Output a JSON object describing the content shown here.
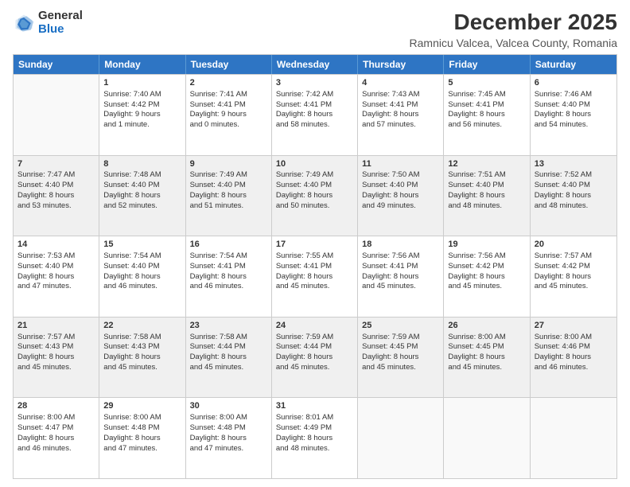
{
  "logo": {
    "general": "General",
    "blue": "Blue"
  },
  "title": "December 2025",
  "subtitle": "Ramnicu Valcea, Valcea County, Romania",
  "header_days": [
    "Sunday",
    "Monday",
    "Tuesday",
    "Wednesday",
    "Thursday",
    "Friday",
    "Saturday"
  ],
  "rows": [
    [
      {
        "day": "",
        "content": "",
        "empty": true
      },
      {
        "day": "1",
        "content": "Sunrise: 7:40 AM\nSunset: 4:42 PM\nDaylight: 9 hours\nand 1 minute."
      },
      {
        "day": "2",
        "content": "Sunrise: 7:41 AM\nSunset: 4:41 PM\nDaylight: 9 hours\nand 0 minutes."
      },
      {
        "day": "3",
        "content": "Sunrise: 7:42 AM\nSunset: 4:41 PM\nDaylight: 8 hours\nand 58 minutes."
      },
      {
        "day": "4",
        "content": "Sunrise: 7:43 AM\nSunset: 4:41 PM\nDaylight: 8 hours\nand 57 minutes."
      },
      {
        "day": "5",
        "content": "Sunrise: 7:45 AM\nSunset: 4:41 PM\nDaylight: 8 hours\nand 56 minutes."
      },
      {
        "day": "6",
        "content": "Sunrise: 7:46 AM\nSunset: 4:40 PM\nDaylight: 8 hours\nand 54 minutes."
      }
    ],
    [
      {
        "day": "7",
        "content": "Sunrise: 7:47 AM\nSunset: 4:40 PM\nDaylight: 8 hours\nand 53 minutes.",
        "shaded": true
      },
      {
        "day": "8",
        "content": "Sunrise: 7:48 AM\nSunset: 4:40 PM\nDaylight: 8 hours\nand 52 minutes.",
        "shaded": true
      },
      {
        "day": "9",
        "content": "Sunrise: 7:49 AM\nSunset: 4:40 PM\nDaylight: 8 hours\nand 51 minutes.",
        "shaded": true
      },
      {
        "day": "10",
        "content": "Sunrise: 7:49 AM\nSunset: 4:40 PM\nDaylight: 8 hours\nand 50 minutes.",
        "shaded": true
      },
      {
        "day": "11",
        "content": "Sunrise: 7:50 AM\nSunset: 4:40 PM\nDaylight: 8 hours\nand 49 minutes.",
        "shaded": true
      },
      {
        "day": "12",
        "content": "Sunrise: 7:51 AM\nSunset: 4:40 PM\nDaylight: 8 hours\nand 48 minutes.",
        "shaded": true
      },
      {
        "day": "13",
        "content": "Sunrise: 7:52 AM\nSunset: 4:40 PM\nDaylight: 8 hours\nand 48 minutes.",
        "shaded": true
      }
    ],
    [
      {
        "day": "14",
        "content": "Sunrise: 7:53 AM\nSunset: 4:40 PM\nDaylight: 8 hours\nand 47 minutes."
      },
      {
        "day": "15",
        "content": "Sunrise: 7:54 AM\nSunset: 4:40 PM\nDaylight: 8 hours\nand 46 minutes."
      },
      {
        "day": "16",
        "content": "Sunrise: 7:54 AM\nSunset: 4:41 PM\nDaylight: 8 hours\nand 46 minutes."
      },
      {
        "day": "17",
        "content": "Sunrise: 7:55 AM\nSunset: 4:41 PM\nDaylight: 8 hours\nand 45 minutes."
      },
      {
        "day": "18",
        "content": "Sunrise: 7:56 AM\nSunset: 4:41 PM\nDaylight: 8 hours\nand 45 minutes."
      },
      {
        "day": "19",
        "content": "Sunrise: 7:56 AM\nSunset: 4:42 PM\nDaylight: 8 hours\nand 45 minutes."
      },
      {
        "day": "20",
        "content": "Sunrise: 7:57 AM\nSunset: 4:42 PM\nDaylight: 8 hours\nand 45 minutes."
      }
    ],
    [
      {
        "day": "21",
        "content": "Sunrise: 7:57 AM\nSunset: 4:43 PM\nDaylight: 8 hours\nand 45 minutes.",
        "shaded": true
      },
      {
        "day": "22",
        "content": "Sunrise: 7:58 AM\nSunset: 4:43 PM\nDaylight: 8 hours\nand 45 minutes.",
        "shaded": true
      },
      {
        "day": "23",
        "content": "Sunrise: 7:58 AM\nSunset: 4:44 PM\nDaylight: 8 hours\nand 45 minutes.",
        "shaded": true
      },
      {
        "day": "24",
        "content": "Sunrise: 7:59 AM\nSunset: 4:44 PM\nDaylight: 8 hours\nand 45 minutes.",
        "shaded": true
      },
      {
        "day": "25",
        "content": "Sunrise: 7:59 AM\nSunset: 4:45 PM\nDaylight: 8 hours\nand 45 minutes.",
        "shaded": true
      },
      {
        "day": "26",
        "content": "Sunrise: 8:00 AM\nSunset: 4:45 PM\nDaylight: 8 hours\nand 45 minutes.",
        "shaded": true
      },
      {
        "day": "27",
        "content": "Sunrise: 8:00 AM\nSunset: 4:46 PM\nDaylight: 8 hours\nand 46 minutes.",
        "shaded": true
      }
    ],
    [
      {
        "day": "28",
        "content": "Sunrise: 8:00 AM\nSunset: 4:47 PM\nDaylight: 8 hours\nand 46 minutes."
      },
      {
        "day": "29",
        "content": "Sunrise: 8:00 AM\nSunset: 4:48 PM\nDaylight: 8 hours\nand 47 minutes."
      },
      {
        "day": "30",
        "content": "Sunrise: 8:00 AM\nSunset: 4:48 PM\nDaylight: 8 hours\nand 47 minutes."
      },
      {
        "day": "31",
        "content": "Sunrise: 8:01 AM\nSunset: 4:49 PM\nDaylight: 8 hours\nand 48 minutes."
      },
      {
        "day": "",
        "content": "",
        "empty": true
      },
      {
        "day": "",
        "content": "",
        "empty": true
      },
      {
        "day": "",
        "content": "",
        "empty": true
      }
    ]
  ]
}
